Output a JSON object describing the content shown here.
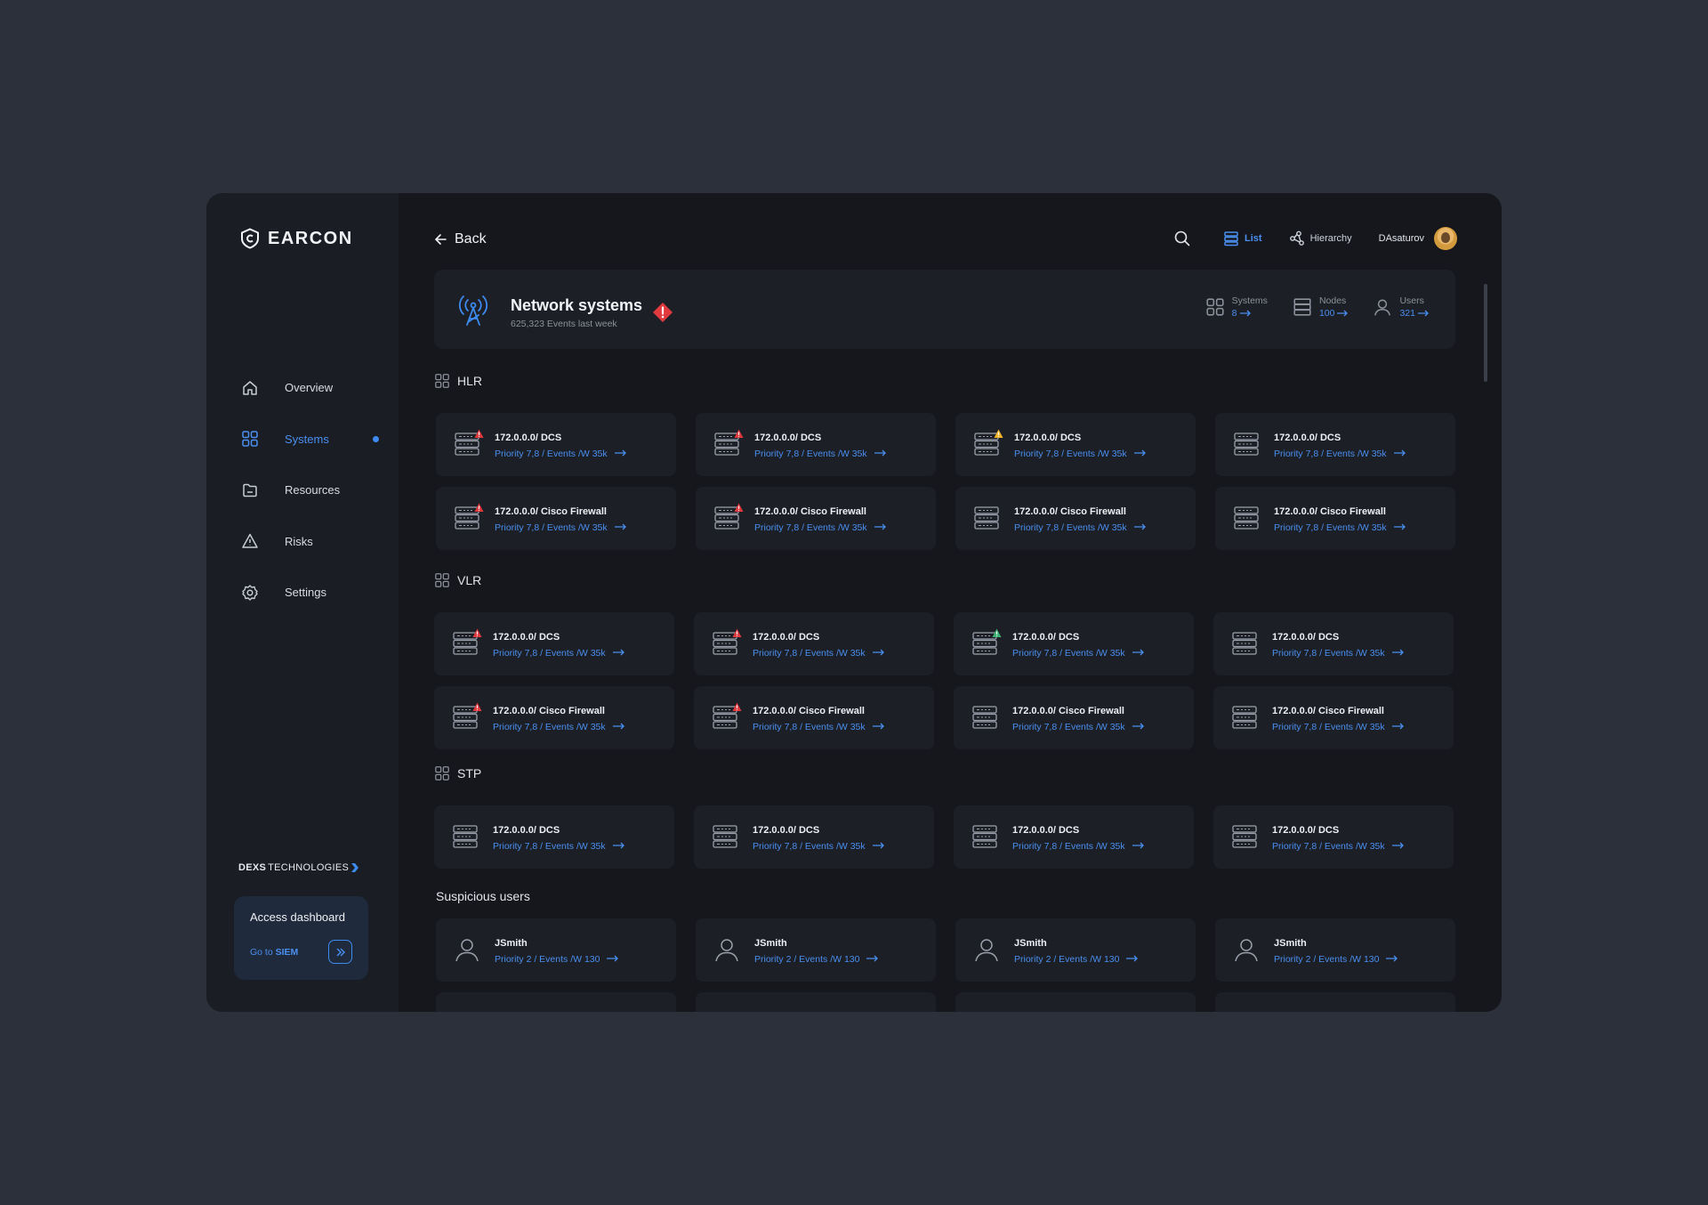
{
  "logo": {
    "text": "EARCON"
  },
  "nav": [
    {
      "label": "Overview",
      "icon": "home-icon",
      "active": false
    },
    {
      "label": "Systems",
      "icon": "grid-icon",
      "active": true
    },
    {
      "label": "Resources",
      "icon": "folder-icon",
      "active": false
    },
    {
      "label": "Risks",
      "icon": "warning-icon",
      "active": false
    },
    {
      "label": "Settings",
      "icon": "gear-icon",
      "active": false
    }
  ],
  "brand": {
    "bold": "DEXS",
    "rest": "TECHNOLOGIES"
  },
  "access": {
    "title": "Access dashboard",
    "link_prefix": "Go to",
    "link_bold": "SIEM"
  },
  "back_label": "Back",
  "views": {
    "list": "List",
    "hierarchy": "Hierarchy"
  },
  "user": {
    "name": "DAsaturov"
  },
  "header": {
    "title": "Network systems",
    "subtitle": "625,323 Events last week",
    "stats": [
      {
        "label": "Systems",
        "value": "8",
        "icon": "grid-icon"
      },
      {
        "label": "Nodes",
        "value": "100",
        "icon": "server-icon"
      },
      {
        "label": "Users",
        "value": "321",
        "icon": "user-icon"
      }
    ]
  },
  "sections": {
    "hlr": "HLR",
    "vlr": "VLR",
    "stp": "STP",
    "users": "Suspicious users"
  },
  "cards": {
    "dcs": "172.0.0.0/ DCS",
    "firewall": "172.0.0.0/ Cisco Firewall",
    "priority": "Priority 7,8 / Events /W 35k",
    "user_name": "JSmith",
    "user_priority": "Priority 2 / Events /W 130"
  },
  "colors": {
    "accent": "#3d8bf0",
    "alert_red": "#e0393e",
    "alert_yellow": "#f0b429",
    "alert_green": "#3bb273"
  },
  "hlr_badges": [
    "red",
    "red",
    "yellow",
    "none",
    "red",
    "red",
    "none",
    "none"
  ],
  "vlr_badges": [
    "red",
    "red",
    "green",
    "none",
    "red",
    "red",
    "none",
    "none"
  ],
  "stp_badges": [
    "none",
    "none",
    "none",
    "none"
  ]
}
